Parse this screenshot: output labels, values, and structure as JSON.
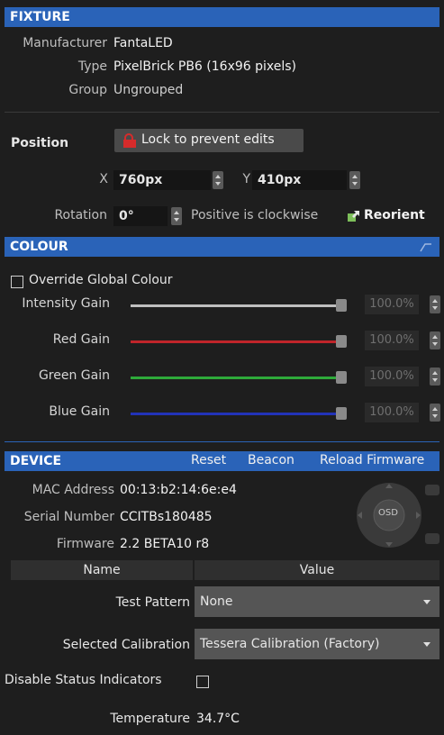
{
  "fixture": {
    "header": "FIXTURE",
    "manufacturer_label": "Manufacturer",
    "manufacturer": "FantaLED",
    "type_label": "Type",
    "type": "PixelBrick PB6 (16x96 pixels)",
    "group_label": "Group",
    "group": "Ungrouped"
  },
  "position": {
    "label": "Position",
    "lock_button": "Lock to prevent edits",
    "x_label": "X",
    "x_value": "760px",
    "y_label": "Y",
    "y_value": "410px",
    "rotation_label": "Rotation",
    "rotation_value": "0°",
    "rotation_hint": "Positive is clockwise",
    "reorient_button": "Reorient"
  },
  "colour": {
    "header": "COLOUR",
    "override_label": "Override Global Colour",
    "gains": [
      {
        "label": "Intensity Gain",
        "value": "100.0%",
        "level": 1.0,
        "color": "#bfbfbf"
      },
      {
        "label": "Red Gain",
        "value": "100.0%",
        "level": 1.0,
        "color": "#c0252a"
      },
      {
        "label": "Green Gain",
        "value": "100.0%",
        "level": 1.0,
        "color": "#2eaa3a"
      },
      {
        "label": "Blue Gain",
        "value": "100.0%",
        "level": 1.0,
        "color": "#2233b8"
      }
    ]
  },
  "device": {
    "header": "DEVICE",
    "reset": "Reset",
    "beacon": "Beacon",
    "reload_firmware": "Reload Firmware",
    "mac_label": "MAC Address",
    "mac": "00:13:b2:14:6e:e4",
    "serial_label": "Serial Number",
    "serial": "CCITBs180485",
    "firmware_label": "Firmware",
    "firmware": "2.2 BETA10 r8",
    "osd_label": "OSD",
    "table_name": "Name",
    "table_value": "Value",
    "test_pattern_label": "Test Pattern",
    "test_pattern": "None",
    "calibration_label": "Selected Calibration",
    "calibration": "Tessera Calibration (Factory)",
    "disable_status_label": "Disable Status Indicators",
    "temperature_label": "Temperature",
    "temperature": "34.7°C"
  }
}
